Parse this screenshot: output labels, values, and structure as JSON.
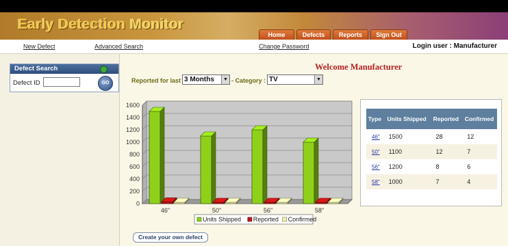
{
  "app": {
    "title_part1": "Early Detection",
    "title_part2": "Monitor"
  },
  "nav_tabs": [
    "Home",
    "Defects",
    "Reports",
    "Sign Out"
  ],
  "links": {
    "new_defect": "New Defect",
    "advanced_search": "Advanced Search",
    "change_password": "Change Password"
  },
  "login": "Login user : Manufacturer",
  "sidebar": {
    "title": "Defect Search",
    "defect_id_label": "Defect ID",
    "defect_id_value": "",
    "go_label": "GO"
  },
  "welcome": "Welcome Manufacturer",
  "filters": {
    "reported_label": "Reported for last :",
    "reported_value": "3 Months",
    "category_label": "- Category :",
    "category_value": "TV"
  },
  "table": {
    "headers": [
      "Type",
      "Units Shipped",
      "Reported",
      "Confirmed"
    ],
    "rows": [
      {
        "type": "46\"",
        "shipped": "1500",
        "reported": "28",
        "confirmed": "12"
      },
      {
        "type": "50\"",
        "shipped": "1100",
        "reported": "12",
        "confirmed": "7"
      },
      {
        "type": "56\"",
        "shipped": "1200",
        "reported": "8",
        "confirmed": "6"
      },
      {
        "type": "58\"",
        "shipped": "1000",
        "reported": "7",
        "confirmed": "4"
      }
    ]
  },
  "create_button": "Create your own defect",
  "chart_data": {
    "type": "bar",
    "categories": [
      "46\"",
      "50\"",
      "56\"",
      "58\""
    ],
    "series": [
      {
        "name": "Units Shipped",
        "values": [
          1500,
          1100,
          1200,
          1000
        ],
        "color": "#8fd11a"
      },
      {
        "name": "Reported",
        "values": [
          28,
          12,
          8,
          7
        ],
        "color": "#c21515"
      },
      {
        "name": "Confirmed",
        "values": [
          12,
          7,
          6,
          4
        ],
        "color": "#eef0a8"
      }
    ],
    "yticks": [
      "0",
      "200",
      "400",
      "600",
      "800",
      "1000",
      "1200",
      "1400",
      "1600"
    ],
    "ylim": [
      0,
      1600
    ],
    "grid": true,
    "legend_position": "bottom",
    "chart_type_style": "3d-bar"
  }
}
